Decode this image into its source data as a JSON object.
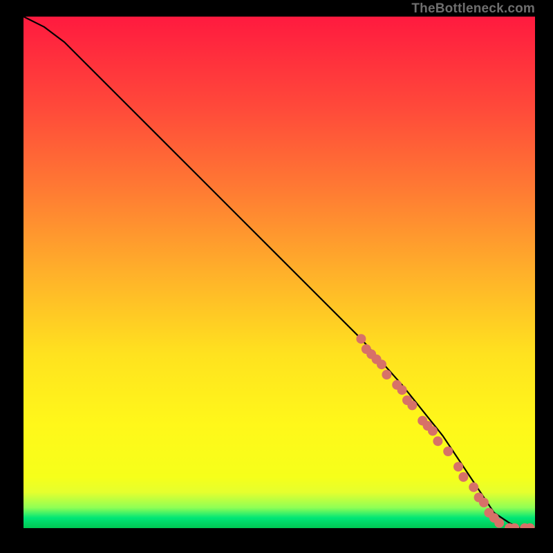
{
  "watermark": "TheBottleneck.com",
  "chart_data": {
    "type": "line",
    "title": "",
    "xlabel": "",
    "ylabel": "",
    "xlim": [
      0,
      100
    ],
    "ylim": [
      0,
      100
    ],
    "series": [
      {
        "name": "curve",
        "x": [
          0,
          4,
          8,
          12,
          18,
          26,
          34,
          42,
          50,
          58,
          66,
          74,
          82,
          88,
          92,
          95,
          97,
          100
        ],
        "values": [
          100,
          98,
          95,
          91,
          85,
          77,
          69,
          61,
          53,
          45,
          37,
          28,
          18,
          9,
          3,
          1,
          0,
          0
        ]
      }
    ],
    "markers": [
      {
        "x": 66,
        "y": 37
      },
      {
        "x": 67,
        "y": 35
      },
      {
        "x": 68,
        "y": 34
      },
      {
        "x": 69,
        "y": 33
      },
      {
        "x": 70,
        "y": 32
      },
      {
        "x": 71,
        "y": 30
      },
      {
        "x": 73,
        "y": 28
      },
      {
        "x": 74,
        "y": 27
      },
      {
        "x": 75,
        "y": 25
      },
      {
        "x": 76,
        "y": 24
      },
      {
        "x": 78,
        "y": 21
      },
      {
        "x": 79,
        "y": 20
      },
      {
        "x": 80,
        "y": 19
      },
      {
        "x": 81,
        "y": 17
      },
      {
        "x": 83,
        "y": 15
      },
      {
        "x": 85,
        "y": 12
      },
      {
        "x": 86,
        "y": 10
      },
      {
        "x": 88,
        "y": 8
      },
      {
        "x": 89,
        "y": 6
      },
      {
        "x": 90,
        "y": 5
      },
      {
        "x": 91,
        "y": 3
      },
      {
        "x": 92,
        "y": 2
      },
      {
        "x": 93,
        "y": 1
      },
      {
        "x": 95,
        "y": 0
      },
      {
        "x": 96,
        "y": 0
      },
      {
        "x": 98,
        "y": 0
      },
      {
        "x": 99,
        "y": 0
      }
    ],
    "colors": {
      "curve": "#000000",
      "marker": "#d77168"
    }
  }
}
